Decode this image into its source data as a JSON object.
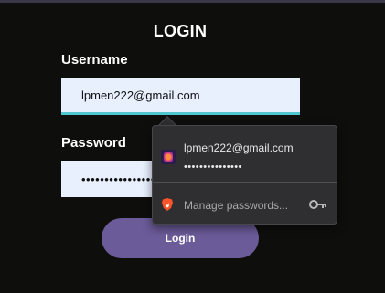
{
  "form": {
    "title": "LOGIN",
    "username_label": "Username",
    "username_value": "lpmen222@gmail.com",
    "password_label": "Password",
    "password_value": "••••••••••••••••",
    "login_label": "Login"
  },
  "autofill": {
    "suggestion_username": "lpmen222@gmail.com",
    "suggestion_password": "•••••••••••••••",
    "manage_label": "Manage passwords...",
    "favicon_icon": "site-favicon",
    "brave_icon": "brave-lion-icon",
    "key_icon": "key-icon"
  },
  "colors": {
    "background": "#0e0e0c",
    "input_bg": "#e8f0fe",
    "input_focus_underline": "#52c6cf",
    "button": "#6b5b99",
    "dropdown_bg": "#2f2f31",
    "brave_orange": "#fb542b"
  }
}
